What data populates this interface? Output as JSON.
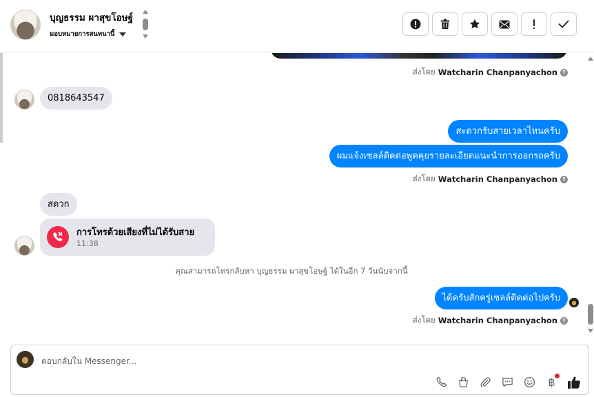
{
  "header": {
    "name": "บุญธรรม ผาสุขโอษฐ์",
    "assign_label": "มอบหมายการสนทนานี้",
    "actions": [
      {
        "id": "report",
        "icon": "alert-circle-icon"
      },
      {
        "id": "delete",
        "icon": "trash-icon"
      },
      {
        "id": "star",
        "icon": "star-icon"
      },
      {
        "id": "mark-unread",
        "icon": "envelope-icon"
      },
      {
        "id": "important",
        "icon": "exclamation-icon"
      },
      {
        "id": "done",
        "icon": "check-icon"
      }
    ]
  },
  "messages": {
    "sent_by_prefix": "ส่งโดย",
    "agent_name": "Watcharin Chanpanyachon",
    "in_phone": "0818643547",
    "out_1": "สะดวกรับสายเวลาไหนครับ",
    "out_2": "ผมแจ้งเซลล์ติดต่อพูดคุยรายละเอียดแนะนำการออกรถครับ",
    "in_convenient": "สดวก",
    "missed_call_title": "การโทรด้วยเสียงที่ไม่ได้รับสาย",
    "missed_call_time": "11:38",
    "callback_notice": "คุณสามารถโทรกลับหา บุญธรรม ผาสุขโอษฐ์ ได้ในอีก 7 วันนับจากนี้",
    "out_3": "ได้ครับสักครู่เซลล์ติดต่อไปครับ"
  },
  "composer": {
    "placeholder": "ตอบกลับใน Messenger...",
    "currency_symbol": "฿",
    "tools": [
      "phone-icon",
      "shopping-bag-icon",
      "paperclip-icon",
      "saved-reply-icon",
      "emoji-icon",
      "payment-icon",
      "like-icon"
    ]
  },
  "colors": {
    "outgoing_bubble": "#0084ff",
    "incoming_bubble": "#e4e6eb",
    "missed_call": "#f02849",
    "notification_dot": "#e41e3f"
  }
}
